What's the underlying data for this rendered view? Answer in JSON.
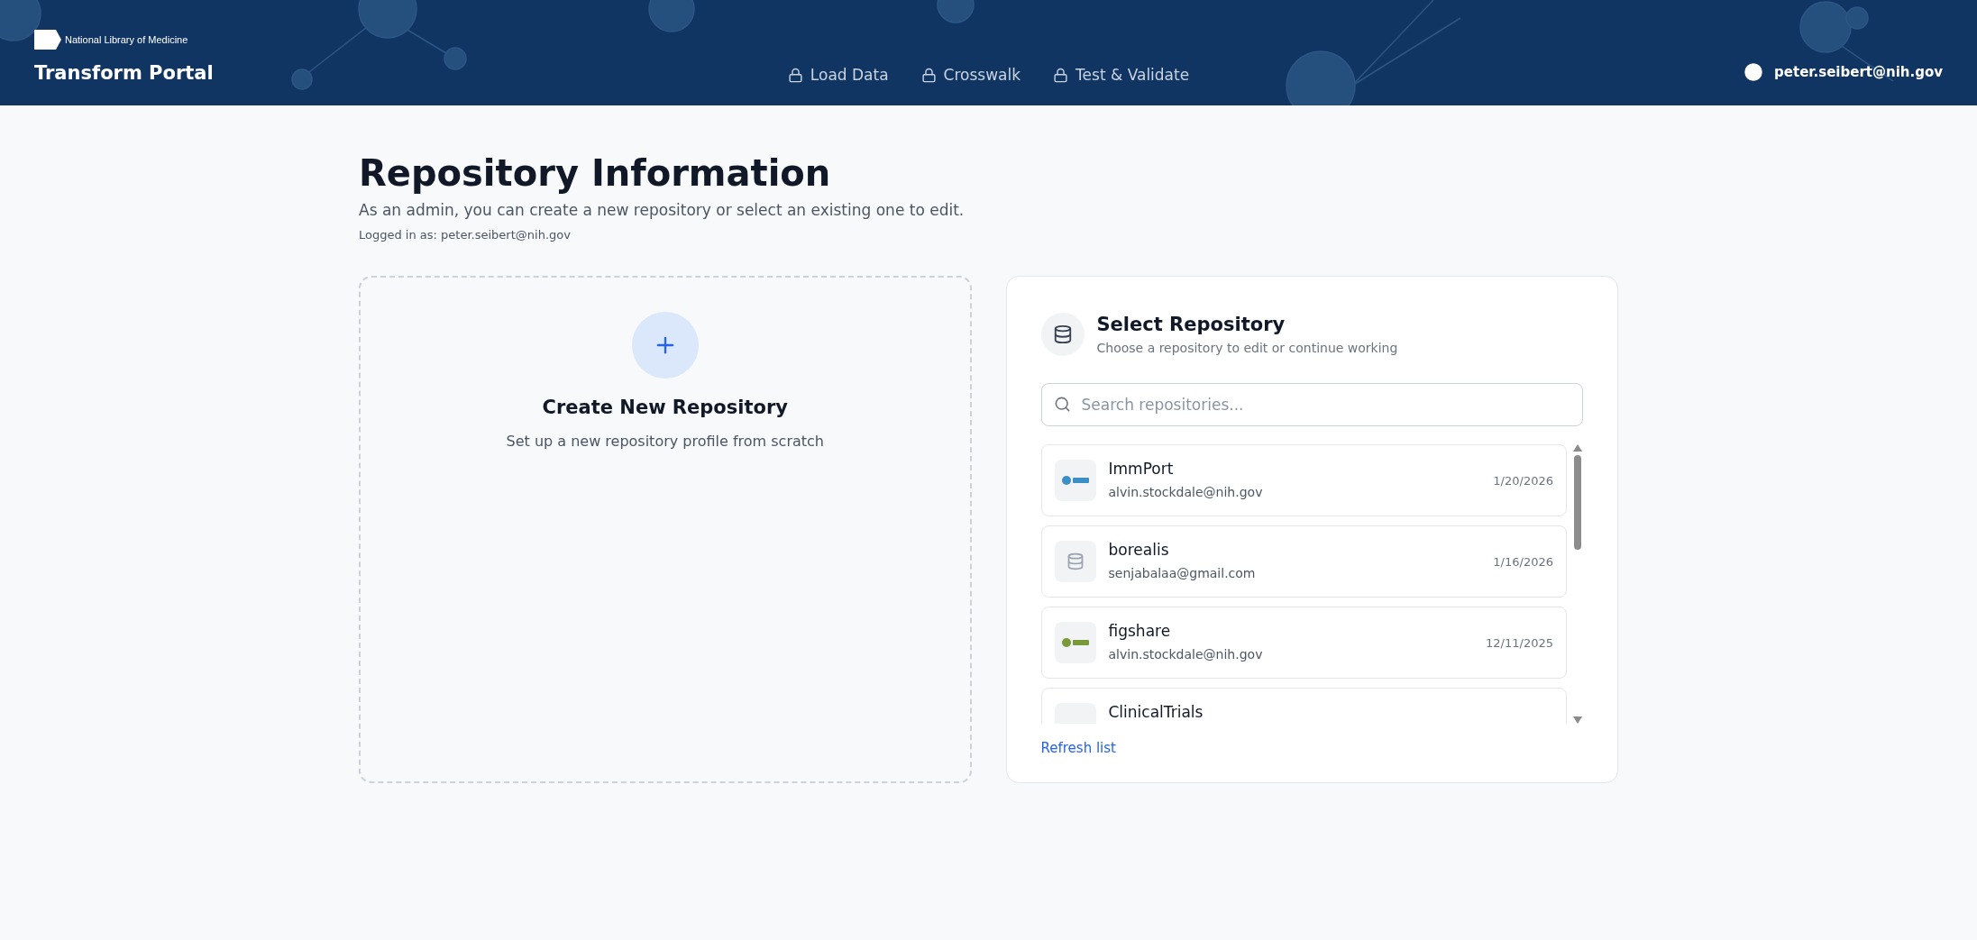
{
  "header": {
    "org": "National Library of Medicine",
    "title": "Transform Portal",
    "nav": [
      {
        "label": "Load Data",
        "locked": true
      },
      {
        "label": "Crosswalk",
        "locked": true
      },
      {
        "label": "Test & Validate",
        "locked": true
      }
    ],
    "user": "peter.seibert@nih.gov"
  },
  "page": {
    "title": "Repository Information",
    "subtitle": "As an admin, you can create a new repository or select an existing one to edit.",
    "logged_in": "Logged in as: peter.seibert@nih.gov"
  },
  "create_card": {
    "title": "Create New Repository",
    "description": "Set up a new repository profile from scratch"
  },
  "select_card": {
    "title": "Select Repository",
    "description": "Choose a repository to edit or continue working",
    "search": {
      "placeholder": "Search repositories..."
    },
    "repositories": [
      {
        "name": "ImmPort",
        "owner": "alvin.stockdale@nih.gov",
        "date": "1/20/2026",
        "kind": "logo",
        "color": "#3b8fc4"
      },
      {
        "name": "borealis",
        "owner": "senjabalaa@gmail.com",
        "date": "1/16/2026",
        "kind": "default"
      },
      {
        "name": "figshare",
        "owner": "alvin.stockdale@nih.gov",
        "date": "12/11/2025",
        "kind": "logo",
        "color": "#7a9a3a"
      },
      {
        "name": "ClinicalTrials",
        "kind": "blank"
      }
    ],
    "refresh": "Refresh list"
  }
}
